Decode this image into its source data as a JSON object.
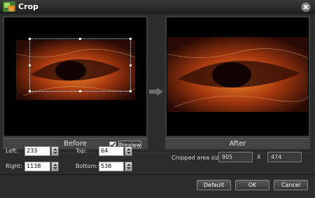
{
  "window": {
    "title": "Crop"
  },
  "panels": {
    "before_label": "Before",
    "after_label": "After",
    "preview_label": "Preview",
    "preview_checked": true
  },
  "fields": {
    "left_label": "Left:",
    "left_value": "233",
    "right_label": "Right:",
    "right_value": "1138",
    "top_label": "Top:",
    "top_value": "64",
    "bottom_label": "Bottom:",
    "bottom_value": "538",
    "cropped_label": "Cropped area size:",
    "cropped_width": "905",
    "cropped_x": "X",
    "cropped_height": "474"
  },
  "buttons": {
    "default": "Default",
    "ok": "OK",
    "cancel": "Cancel"
  },
  "colors": {
    "accent_orange": "#e07020",
    "panel_bg": "#000000"
  }
}
